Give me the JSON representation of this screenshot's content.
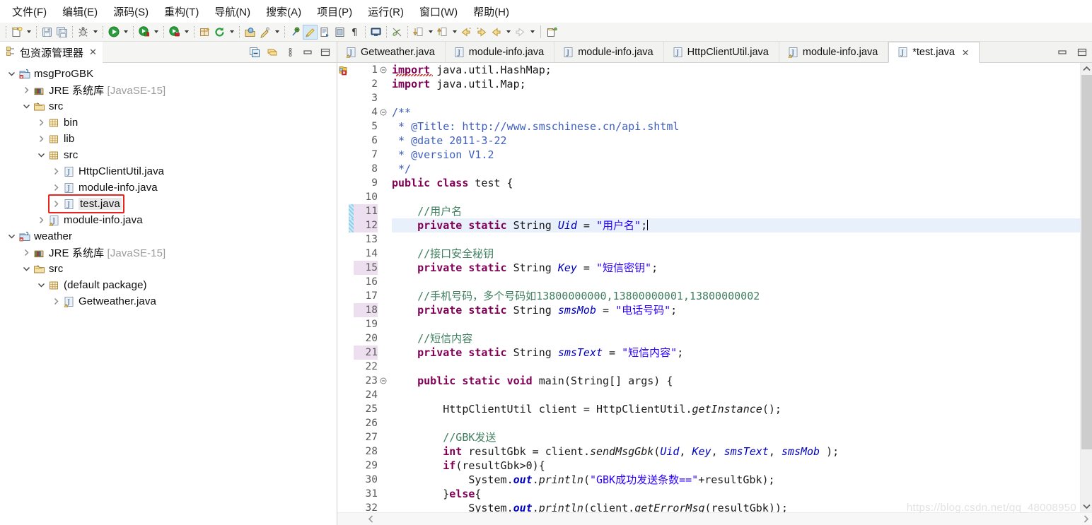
{
  "menu": {
    "items": [
      {
        "label": "文件(F)"
      },
      {
        "label": "编辑(E)"
      },
      {
        "label": "源码(S)"
      },
      {
        "label": "重构(T)"
      },
      {
        "label": "导航(N)"
      },
      {
        "label": "搜索(A)"
      },
      {
        "label": "项目(P)"
      },
      {
        "label": "运行(R)"
      },
      {
        "label": "窗口(W)"
      },
      {
        "label": "帮助(H)"
      }
    ]
  },
  "toolbar": {
    "icons": [
      "new-file-icon",
      "save-icon",
      "save-all-icon",
      "debug-icon",
      "run-icon",
      "coverage-icon",
      "external-tools-icon",
      "new-java-package-icon",
      "refresh-icon",
      "open-type-icon",
      "search-icon",
      "skip-breakpoints-icon",
      "toggle-markoccurrences-icon",
      "new-java-class-icon",
      "show-whitespace-icon",
      "pilcrow-icon",
      "console-icon",
      "link-icon",
      "next-annotation-icon",
      "previous-annotation-icon",
      "back-icon",
      "forward-icon",
      "prev-edit-icon",
      "next-edit-icon",
      "new-window-icon"
    ]
  },
  "explorer": {
    "tab_title": "包资源管理器",
    "tab_close": "✕",
    "tools": [
      "collapse-all-icon",
      "link-with-editor-icon",
      "view-menu-icon",
      "minimize-icon",
      "maximize-icon"
    ],
    "tree": [
      {
        "label": "msgProGBK",
        "dim": "",
        "depth": 0,
        "twist": "open",
        "icon": "java-project-icon",
        "selected": false
      },
      {
        "label": "JRE 系统库",
        "dim": "[JavaSE-15]",
        "depth": 1,
        "twist": "closed",
        "icon": "jre-library-icon",
        "selected": false
      },
      {
        "label": "src",
        "dim": "",
        "depth": 1,
        "twist": "open",
        "icon": "source-folder-icon",
        "selected": false
      },
      {
        "label": "bin",
        "dim": "",
        "depth": 2,
        "twist": "closed",
        "icon": "package-icon",
        "selected": false
      },
      {
        "label": "lib",
        "dim": "",
        "depth": 2,
        "twist": "closed",
        "icon": "package-icon",
        "selected": false
      },
      {
        "label": "src",
        "dim": "",
        "depth": 2,
        "twist": "open",
        "icon": "package-icon",
        "selected": false
      },
      {
        "label": "HttpClientUtil.java",
        "dim": "",
        "depth": 3,
        "twist": "closed",
        "icon": "java-file-icon",
        "selected": false
      },
      {
        "label": "module-info.java",
        "dim": "",
        "depth": 3,
        "twist": "closed",
        "icon": "java-file-icon",
        "selected": false
      },
      {
        "label": "test.java",
        "dim": "",
        "depth": 3,
        "twist": "closed",
        "icon": "java-file-icon",
        "selected": true
      },
      {
        "label": "module-info.java",
        "dim": "",
        "depth": 2,
        "twist": "closed",
        "icon": "java-file-warn-icon",
        "selected": false
      },
      {
        "label": "weather",
        "dim": "",
        "depth": 0,
        "twist": "open",
        "icon": "java-project-icon",
        "selected": false
      },
      {
        "label": "JRE 系统库",
        "dim": "[JavaSE-15]",
        "depth": 1,
        "twist": "closed",
        "icon": "jre-library-icon",
        "selected": false
      },
      {
        "label": "src",
        "dim": "",
        "depth": 1,
        "twist": "open",
        "icon": "source-folder-icon",
        "selected": false
      },
      {
        "label": "(default package)",
        "dim": "",
        "depth": 2,
        "twist": "open",
        "icon": "package-icon",
        "selected": false
      },
      {
        "label": "Getweather.java",
        "dim": "",
        "depth": 3,
        "twist": "closed",
        "icon": "java-file-warn-icon",
        "selected": false
      }
    ]
  },
  "editor": {
    "tabs": [
      {
        "label": "Getweather.java",
        "active": false,
        "dirty": false,
        "icon": "java-file-warn-icon"
      },
      {
        "label": "module-info.java",
        "active": false,
        "dirty": false,
        "icon": "java-file-icon"
      },
      {
        "label": "module-info.java",
        "active": false,
        "dirty": false,
        "icon": "java-file-icon"
      },
      {
        "label": "HttpClientUtil.java",
        "active": false,
        "dirty": false,
        "icon": "java-file-icon"
      },
      {
        "label": "module-info.java",
        "active": false,
        "dirty": false,
        "icon": "java-file-warn-icon"
      },
      {
        "label": "*test.java",
        "active": true,
        "dirty": true,
        "icon": "java-file-icon",
        "close": "✕"
      }
    ],
    "tools": [
      "minimize-icon",
      "maximize-icon"
    ],
    "first_line": 1,
    "last_line": 32,
    "current_line": 12,
    "changed_lines": [
      11,
      12,
      15,
      18,
      21
    ],
    "folded_lines": [
      1,
      4,
      23
    ],
    "error_line": 1,
    "lines": [
      {
        "n": 1,
        "text": "import java.util.HashMap;"
      },
      {
        "n": 2,
        "text": "import java.util.Map;"
      },
      {
        "n": 3,
        "text": ""
      },
      {
        "n": 4,
        "text": "/**"
      },
      {
        "n": 5,
        "text": " * @Title: http://www.smschinese.cn/api.shtml"
      },
      {
        "n": 6,
        "text": " * @date 2011-3-22"
      },
      {
        "n": 7,
        "text": " * @version V1.2"
      },
      {
        "n": 8,
        "text": " */"
      },
      {
        "n": 9,
        "text": "public class test {"
      },
      {
        "n": 10,
        "text": ""
      },
      {
        "n": 11,
        "text": "    //用户名"
      },
      {
        "n": 12,
        "text": "    private static String Uid = \"用户名\";"
      },
      {
        "n": 13,
        "text": ""
      },
      {
        "n": 14,
        "text": "    //接口安全秘钥"
      },
      {
        "n": 15,
        "text": "    private static String Key = \"短信密钥\";"
      },
      {
        "n": 16,
        "text": ""
      },
      {
        "n": 17,
        "text": "    //手机号码，多个号码如13800000000,13800000001,13800000002"
      },
      {
        "n": 18,
        "text": "    private static String smsMob = \"电话号码\";"
      },
      {
        "n": 19,
        "text": ""
      },
      {
        "n": 20,
        "text": "    //短信内容"
      },
      {
        "n": 21,
        "text": "    private static String smsText = \"短信内容\";"
      },
      {
        "n": 22,
        "text": ""
      },
      {
        "n": 23,
        "text": "    public static void main(String[] args) {"
      },
      {
        "n": 24,
        "text": ""
      },
      {
        "n": 25,
        "text": "        HttpClientUtil client = HttpClientUtil.getInstance();"
      },
      {
        "n": 26,
        "text": ""
      },
      {
        "n": 27,
        "text": "        //GBK发送"
      },
      {
        "n": 28,
        "text": "        int resultGbk = client.sendMsgGbk(Uid, Key, smsText, smsMob );"
      },
      {
        "n": 29,
        "text": "        if(resultGbk>0){"
      },
      {
        "n": 30,
        "text": "            System.out.println(\"GBK成功发送条数==\"+resultGbk);"
      },
      {
        "n": 31,
        "text": "        }else{"
      },
      {
        "n": 32,
        "text": "            System.out.println(client.getErrorMsg(resultGbk));"
      }
    ]
  },
  "watermark": "https://blog.csdn.net/qq_48008950",
  "colors": {
    "keyword": "#7f0055",
    "comment": "#3f7f5f",
    "javadoc": "#3f5fbf",
    "string": "#2a00ff",
    "field": "#0000c0",
    "current_line_bg": "#e8f0fb",
    "changed_line_num_bg": "#eddff0",
    "change_bar": "#7ec6e8",
    "annotation_box": "#e8251f",
    "toolbar_bg": "#f5f5f4"
  }
}
